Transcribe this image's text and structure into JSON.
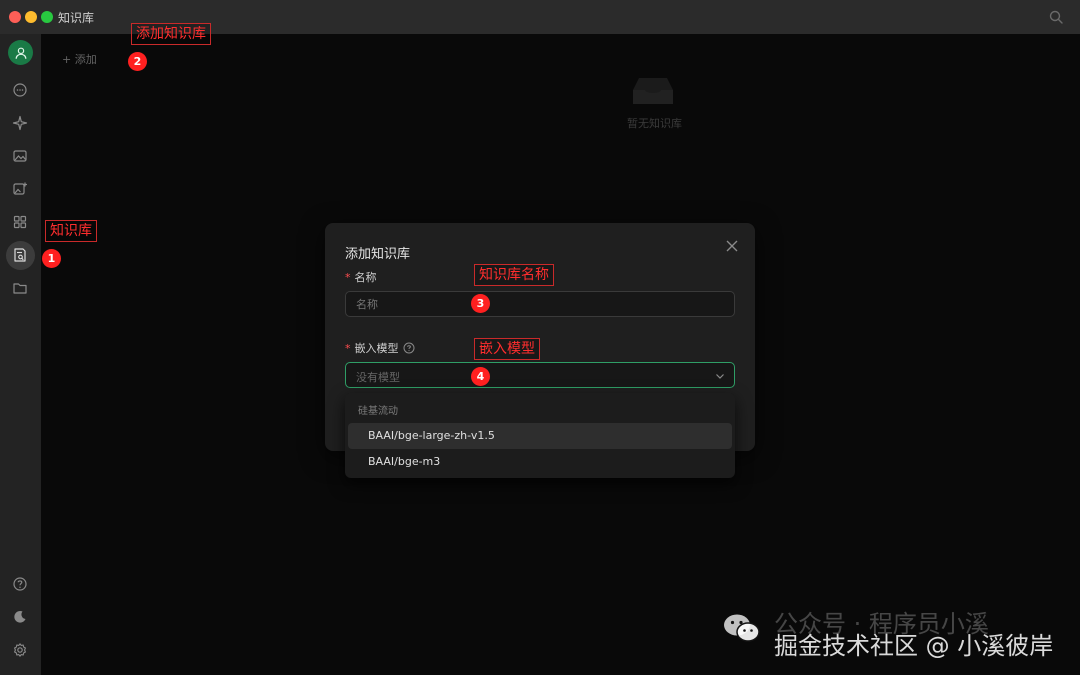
{
  "window": {
    "title": "知识库"
  },
  "colors": {
    "accent": "#2f9e66",
    "annotation": "#ff2e2e",
    "required": "#ff4d4f"
  },
  "sidebar": {
    "items": [
      {
        "icon": "user-avatar-icon"
      },
      {
        "icon": "chat-icon"
      },
      {
        "icon": "sparkle-icon"
      },
      {
        "icon": "image-icon"
      },
      {
        "icon": "image-add-icon"
      },
      {
        "icon": "apps-grid-icon"
      },
      {
        "icon": "knowledge-base-icon",
        "active": true
      },
      {
        "icon": "folder-icon"
      }
    ],
    "bottom_items": [
      {
        "icon": "help-icon"
      },
      {
        "icon": "moon-icon"
      },
      {
        "icon": "gear-icon"
      }
    ]
  },
  "main": {
    "add_label": "+ 添加",
    "empty_text": "暂无知识库"
  },
  "modal": {
    "title": "添加知识库",
    "name_field": {
      "required_mark": "*",
      "label": "名称",
      "placeholder": "名称"
    },
    "model_field": {
      "required_mark": "*",
      "label": "嵌入模型",
      "placeholder": "没有模型"
    },
    "dropdown": {
      "group": "硅基流动",
      "options": [
        "BAAI/bge-large-zh-v1.5",
        "BAAI/bge-m3"
      ]
    }
  },
  "annotations": {
    "add_kb": {
      "text": "添加知识库",
      "number": "2"
    },
    "kb": {
      "text": "知识库",
      "number": "1"
    },
    "kb_name": {
      "text": "知识库名称",
      "number": "3"
    },
    "embed_model": {
      "text": "嵌入模型",
      "number": "4"
    }
  },
  "watermark": {
    "line1": "公众号 · 程序员小溪",
    "line2": "掘金技术社区 @ 小溪彼岸"
  }
}
